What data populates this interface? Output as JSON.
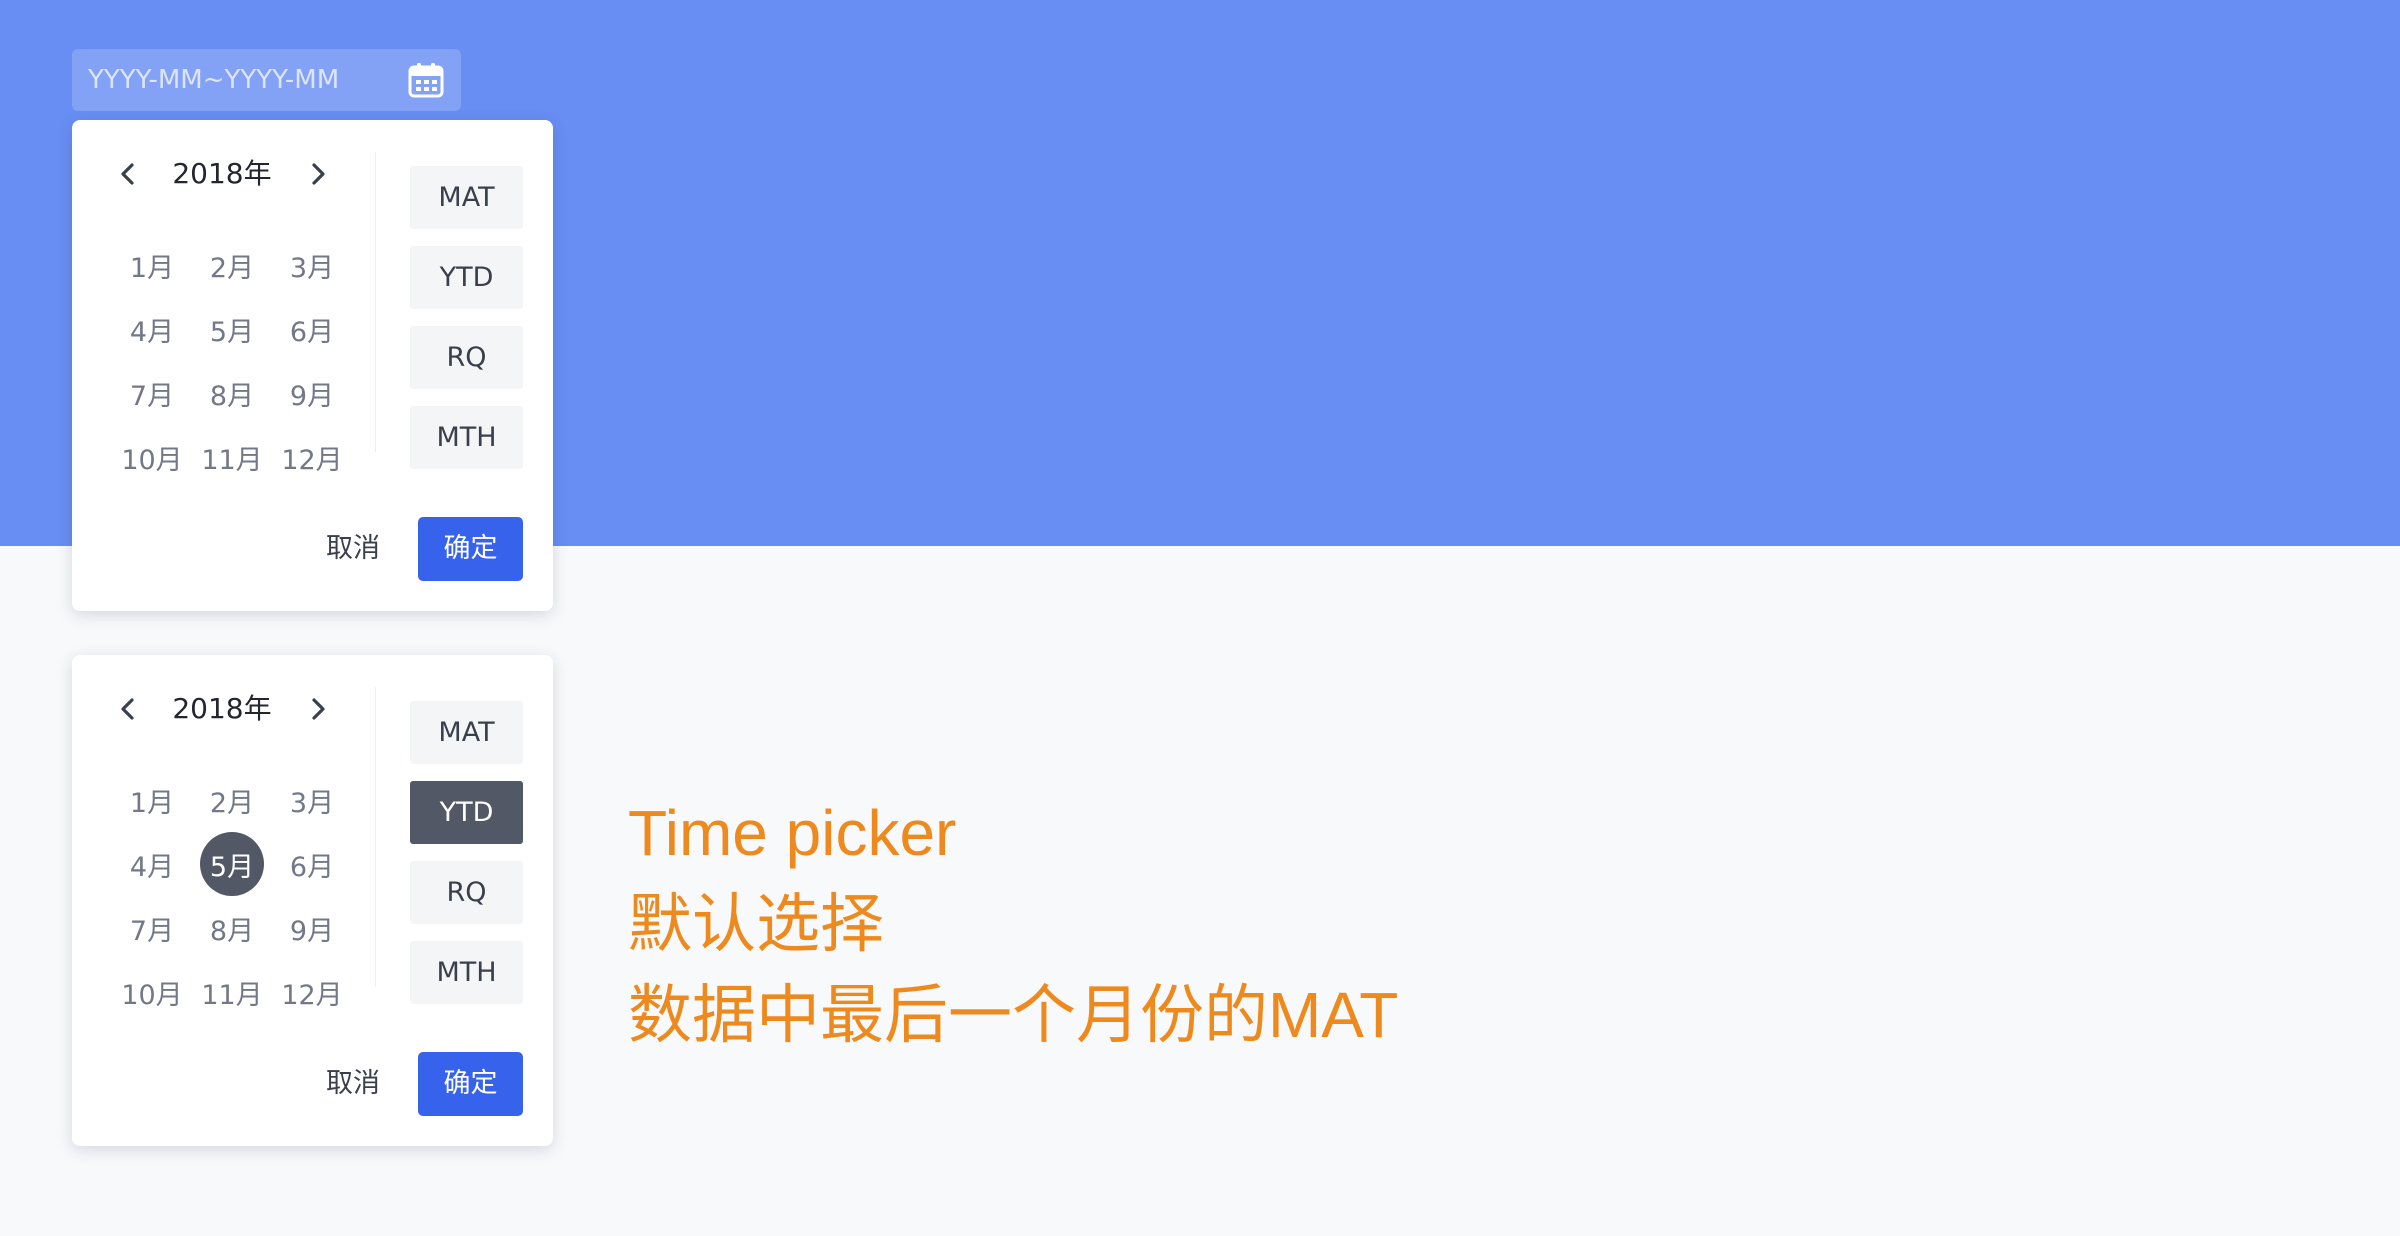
{
  "range_input": {
    "placeholder": "YYYY-MM~YYYY-MM",
    "icon": "calendar-icon"
  },
  "pickers": [
    {
      "year_label": "2018年",
      "months": [
        "1月",
        "2月",
        "3月",
        "4月",
        "5月",
        "6月",
        "7月",
        "8月",
        "9月",
        "10月",
        "11月",
        "12月"
      ],
      "selected_month": null,
      "presets": [
        "MAT",
        "YTD",
        "RQ",
        "MTH"
      ],
      "active_preset": null,
      "cancel_label": "取消",
      "confirm_label": "确定"
    },
    {
      "year_label": "2018年",
      "months": [
        "1月",
        "2月",
        "3月",
        "4月",
        "5月",
        "6月",
        "7月",
        "8月",
        "9月",
        "10月",
        "11月",
        "12月"
      ],
      "selected_month": "5月",
      "presets": [
        "MAT",
        "YTD",
        "RQ",
        "MTH"
      ],
      "active_preset": "YTD",
      "cancel_label": "取消",
      "confirm_label": "确定"
    }
  ],
  "annotation": {
    "line1": "Time picker",
    "line2": "默认选择",
    "line3": "数据中最后一个月份的MAT"
  },
  "colors": {
    "band": "#688ef3",
    "background": "#f8f9fb",
    "primary": "#3662ec",
    "selected": "#525865",
    "annotation": "#ee8a1d"
  }
}
